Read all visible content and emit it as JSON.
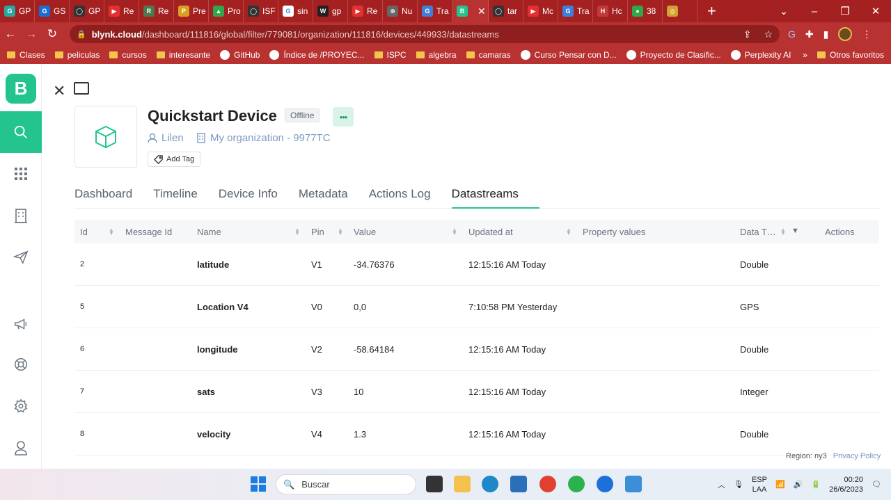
{
  "browser": {
    "tabs": [
      {
        "label": "GP",
        "color": "#2aa7a0",
        "glyph": "G"
      },
      {
        "label": "GS",
        "color": "#1b6ed1",
        "glyph": "G"
      },
      {
        "label": "GP",
        "color": "#333333",
        "glyph": "◯"
      },
      {
        "label": "Re",
        "color": "#e33030",
        "glyph": "▶"
      },
      {
        "label": "Re",
        "color": "#4c7a4c",
        "glyph": "R"
      },
      {
        "label": "Pre",
        "color": "#d9a020",
        "glyph": "P"
      },
      {
        "label": "Pro",
        "color": "#2ea84a",
        "glyph": "▲"
      },
      {
        "label": "ISF",
        "color": "#333333",
        "glyph": "◯"
      },
      {
        "label": "sin",
        "color": "#ffffff",
        "glyph": "G"
      },
      {
        "label": "gp",
        "color": "#222222",
        "glyph": "W"
      },
      {
        "label": "Re",
        "color": "#e33030",
        "glyph": "▶"
      },
      {
        "label": "Nu",
        "color": "#666666",
        "glyph": "⊛"
      },
      {
        "label": "Tra",
        "color": "#3f7fdb",
        "glyph": "G"
      },
      {
        "label": "",
        "color": "#23c48e",
        "glyph": "B",
        "active": true
      },
      {
        "label": "tar",
        "color": "#333333",
        "glyph": "◯"
      },
      {
        "label": "Mc",
        "color": "#e33030",
        "glyph": "▶"
      },
      {
        "label": "Tra",
        "color": "#3f7fdb",
        "glyph": "G"
      },
      {
        "label": "Hc",
        "color": "#c03a3a",
        "glyph": "H"
      },
      {
        "label": "38",
        "color": "#2ea84a",
        "glyph": "●"
      },
      {
        "label": "",
        "color": "#d4a030",
        "glyph": "◎"
      }
    ],
    "active_tab_close": "✕",
    "new_tab": "+",
    "url_host": "blynk.cloud",
    "url_path": "/dashboard/111816/global/filter/779081/organization/111816/devices/449933/datastreams",
    "bookmarks": [
      {
        "label": "Clases",
        "type": "folder"
      },
      {
        "label": "peliculas",
        "type": "folder"
      },
      {
        "label": "cursos",
        "type": "folder"
      },
      {
        "label": "interesante",
        "type": "folder"
      },
      {
        "label": "GitHub",
        "type": "site"
      },
      {
        "label": "Índice de /PROYEC...",
        "type": "site"
      },
      {
        "label": "ISPC",
        "type": "folder"
      },
      {
        "label": "algebra",
        "type": "folder"
      },
      {
        "label": "camaras",
        "type": "folder"
      },
      {
        "label": "Curso Pensar con D...",
        "type": "site"
      },
      {
        "label": "Proyecto de Clasific...",
        "type": "site"
      },
      {
        "label": "Perplexity AI",
        "type": "site"
      }
    ],
    "bookmarks_more": "»",
    "other_bookmarks": "Otros favoritos"
  },
  "sidebar": {
    "logo": "B",
    "items": [
      {
        "icon": "search-icon",
        "active": true
      },
      {
        "icon": "grid-icon"
      },
      {
        "icon": "building-icon"
      },
      {
        "icon": "send-icon"
      },
      {
        "icon": "megaphone-icon"
      },
      {
        "icon": "lifebuoy-icon"
      },
      {
        "icon": "gear-icon"
      },
      {
        "icon": "user-icon"
      }
    ]
  },
  "device": {
    "title": "Quickstart Device",
    "status": "Offline",
    "more": "•••",
    "owner": "Lilen",
    "organization": "My organization - 9977TC",
    "add_tag": "Add Tag"
  },
  "tabs": [
    {
      "label": "Dashboard"
    },
    {
      "label": "Timeline"
    },
    {
      "label": "Device Info"
    },
    {
      "label": "Metadata"
    },
    {
      "label": "Actions Log"
    },
    {
      "label": "Datastreams",
      "active": true
    }
  ],
  "table": {
    "columns": [
      "Id",
      "Message Id",
      "Name",
      "Pin",
      "Value",
      "Updated at",
      "Property values",
      "Data T…",
      "Actions"
    ],
    "rows": [
      {
        "id": "2",
        "message_id": "",
        "name": "latitude",
        "pin": "V1",
        "value": "-34.76376",
        "updated": "12:15:16 AM Today",
        "property": "",
        "type": "Double"
      },
      {
        "id": "5",
        "message_id": "",
        "name": "Location V4",
        "pin": "V0",
        "value": "0,0",
        "updated": "7:10:58 PM Yesterday",
        "property": "",
        "type": "GPS"
      },
      {
        "id": "6",
        "message_id": "",
        "name": "longitude",
        "pin": "V2",
        "value": "-58.64184",
        "updated": "12:15:16 AM Today",
        "property": "",
        "type": "Double"
      },
      {
        "id": "7",
        "message_id": "",
        "name": "sats",
        "pin": "V3",
        "value": "10",
        "updated": "12:15:16 AM Today",
        "property": "",
        "type": "Integer"
      },
      {
        "id": "8",
        "message_id": "",
        "name": "velocity",
        "pin": "V4",
        "value": "1.3",
        "updated": "12:15:16 AM Today",
        "property": "",
        "type": "Double"
      }
    ]
  },
  "footer": {
    "region": "Region: ny3",
    "privacy": "Privacy Policy"
  },
  "taskbar": {
    "search_placeholder": "Buscar",
    "lang_1": "ESP",
    "lang_2": "LAA",
    "time": "00:20",
    "date": "26/6/2023"
  },
  "colors": {
    "accent": "#23c48e",
    "browser_red": "#b93232",
    "link_blue": "#7c99c2"
  }
}
